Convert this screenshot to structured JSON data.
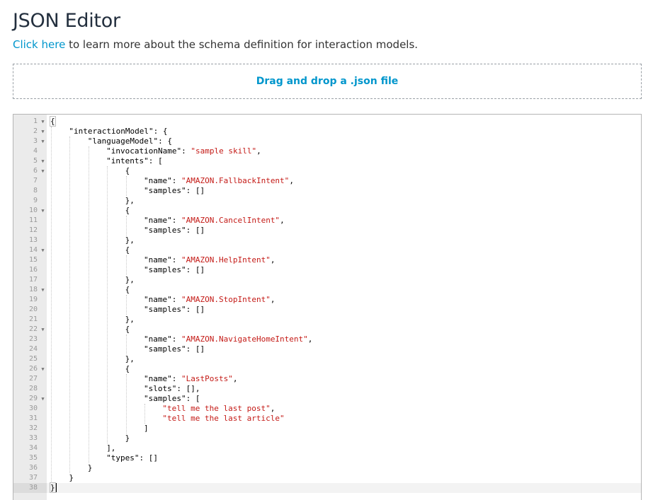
{
  "header": {
    "title": "JSON Editor",
    "link_text": "Click here",
    "subtitle_rest": " to learn more about the schema definition for interaction models."
  },
  "dropzone": {
    "label": "Drag and drop a .json file"
  },
  "editor": {
    "active_line": 38,
    "lines": [
      {
        "n": "1",
        "fold": true,
        "indent": 0,
        "parts": [
          [
            "t",
            "{"
          ]
        ]
      },
      {
        "n": "2",
        "fold": true,
        "indent": 1,
        "parts": [
          [
            "t",
            "\"interactionModel\": {"
          ]
        ]
      },
      {
        "n": "3",
        "fold": true,
        "indent": 2,
        "parts": [
          [
            "t",
            "\"languageModel\": {"
          ]
        ]
      },
      {
        "n": "4",
        "fold": false,
        "indent": 3,
        "parts": [
          [
            "t",
            "\"invocationName\": "
          ],
          [
            "s",
            "\"sample skill\""
          ],
          [
            "t",
            ","
          ]
        ]
      },
      {
        "n": "5",
        "fold": true,
        "indent": 3,
        "parts": [
          [
            "t",
            "\"intents\": ["
          ]
        ]
      },
      {
        "n": "6",
        "fold": true,
        "indent": 4,
        "parts": [
          [
            "t",
            "{"
          ]
        ]
      },
      {
        "n": "7",
        "fold": false,
        "indent": 5,
        "parts": [
          [
            "t",
            "\"name\": "
          ],
          [
            "s",
            "\"AMAZON.FallbackIntent\""
          ],
          [
            "t",
            ","
          ]
        ]
      },
      {
        "n": "8",
        "fold": false,
        "indent": 5,
        "parts": [
          [
            "t",
            "\"samples\": []"
          ]
        ]
      },
      {
        "n": "9",
        "fold": false,
        "indent": 4,
        "parts": [
          [
            "t",
            "},"
          ]
        ]
      },
      {
        "n": "10",
        "fold": true,
        "indent": 4,
        "parts": [
          [
            "t",
            "{"
          ]
        ]
      },
      {
        "n": "11",
        "fold": false,
        "indent": 5,
        "parts": [
          [
            "t",
            "\"name\": "
          ],
          [
            "s",
            "\"AMAZON.CancelIntent\""
          ],
          [
            "t",
            ","
          ]
        ]
      },
      {
        "n": "12",
        "fold": false,
        "indent": 5,
        "parts": [
          [
            "t",
            "\"samples\": []"
          ]
        ]
      },
      {
        "n": "13",
        "fold": false,
        "indent": 4,
        "parts": [
          [
            "t",
            "},"
          ]
        ]
      },
      {
        "n": "14",
        "fold": true,
        "indent": 4,
        "parts": [
          [
            "t",
            "{"
          ]
        ]
      },
      {
        "n": "15",
        "fold": false,
        "indent": 5,
        "parts": [
          [
            "t",
            "\"name\": "
          ],
          [
            "s",
            "\"AMAZON.HelpIntent\""
          ],
          [
            "t",
            ","
          ]
        ]
      },
      {
        "n": "16",
        "fold": false,
        "indent": 5,
        "parts": [
          [
            "t",
            "\"samples\": []"
          ]
        ]
      },
      {
        "n": "17",
        "fold": false,
        "indent": 4,
        "parts": [
          [
            "t",
            "},"
          ]
        ]
      },
      {
        "n": "18",
        "fold": true,
        "indent": 4,
        "parts": [
          [
            "t",
            "{"
          ]
        ]
      },
      {
        "n": "19",
        "fold": false,
        "indent": 5,
        "parts": [
          [
            "t",
            "\"name\": "
          ],
          [
            "s",
            "\"AMAZON.StopIntent\""
          ],
          [
            "t",
            ","
          ]
        ]
      },
      {
        "n": "20",
        "fold": false,
        "indent": 5,
        "parts": [
          [
            "t",
            "\"samples\": []"
          ]
        ]
      },
      {
        "n": "21",
        "fold": false,
        "indent": 4,
        "parts": [
          [
            "t",
            "},"
          ]
        ]
      },
      {
        "n": "22",
        "fold": true,
        "indent": 4,
        "parts": [
          [
            "t",
            "{"
          ]
        ]
      },
      {
        "n": "23",
        "fold": false,
        "indent": 5,
        "parts": [
          [
            "t",
            "\"name\": "
          ],
          [
            "s",
            "\"AMAZON.NavigateHomeIntent\""
          ],
          [
            "t",
            ","
          ]
        ]
      },
      {
        "n": "24",
        "fold": false,
        "indent": 5,
        "parts": [
          [
            "t",
            "\"samples\": []"
          ]
        ]
      },
      {
        "n": "25",
        "fold": false,
        "indent": 4,
        "parts": [
          [
            "t",
            "},"
          ]
        ]
      },
      {
        "n": "26",
        "fold": true,
        "indent": 4,
        "parts": [
          [
            "t",
            "{"
          ]
        ]
      },
      {
        "n": "27",
        "fold": false,
        "indent": 5,
        "parts": [
          [
            "t",
            "\"name\": "
          ],
          [
            "s",
            "\"LastPosts\""
          ],
          [
            "t",
            ","
          ]
        ]
      },
      {
        "n": "28",
        "fold": false,
        "indent": 5,
        "parts": [
          [
            "t",
            "\"slots\": [],"
          ]
        ]
      },
      {
        "n": "29",
        "fold": true,
        "indent": 5,
        "parts": [
          [
            "t",
            "\"samples\": ["
          ]
        ]
      },
      {
        "n": "30",
        "fold": false,
        "indent": 6,
        "parts": [
          [
            "s",
            "\"tell me the last post\""
          ],
          [
            "t",
            ","
          ]
        ]
      },
      {
        "n": "31",
        "fold": false,
        "indent": 6,
        "parts": [
          [
            "s",
            "\"tell me the last article\""
          ]
        ]
      },
      {
        "n": "32",
        "fold": false,
        "indent": 5,
        "parts": [
          [
            "t",
            "]"
          ]
        ]
      },
      {
        "n": "33",
        "fold": false,
        "indent": 4,
        "parts": [
          [
            "t",
            "}"
          ]
        ]
      },
      {
        "n": "34",
        "fold": false,
        "indent": 3,
        "parts": [
          [
            "t",
            "],"
          ]
        ]
      },
      {
        "n": "35",
        "fold": false,
        "indent": 3,
        "parts": [
          [
            "t",
            "\"types\": []"
          ]
        ]
      },
      {
        "n": "36",
        "fold": false,
        "indent": 2,
        "parts": [
          [
            "t",
            "}"
          ]
        ]
      },
      {
        "n": "37",
        "fold": false,
        "indent": 1,
        "parts": [
          [
            "t",
            "}"
          ]
        ]
      },
      {
        "n": "38",
        "fold": false,
        "indent": 0,
        "parts": [
          [
            "t",
            "}"
          ]
        ]
      }
    ]
  }
}
